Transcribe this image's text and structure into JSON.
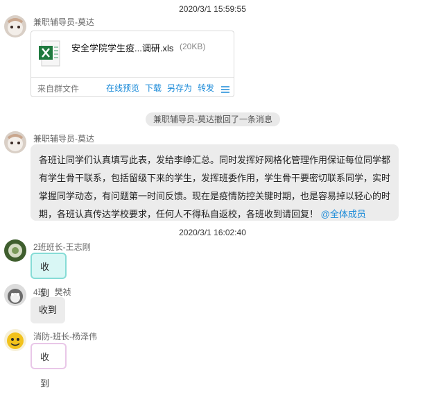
{
  "timestamps": [
    "2020/3/1 15:59:55",
    "2020/3/1 16:02:40"
  ],
  "messages": {
    "m1": {
      "sender": "兼职辅导员-莫达",
      "file": {
        "name": "安全学院学生疫...调研.xls",
        "size": "(20KB)",
        "source": "来自群文件",
        "actions": [
          "在线预览",
          "下载",
          "另存为",
          "转发"
        ]
      }
    },
    "recall_notice": "兼职辅导员-莫达撤回了一条消息",
    "m2": {
      "sender": "兼职辅导员-莫达",
      "text": "各班让同学们认真填写此表，发给李峥汇总。同时发挥好网格化管理作用保证每位同学都有学生骨干联系，包括留级下来的学生，发挥班委作用，学生骨干要密切联系同学，实时掌握同学动态，有问题第一时间反馈。现在是疫情防控关键时期，也是容易掉以轻心的时期，各班认真传达学校要求，任何人不得私自返校，各班收到请回复！",
      "mention": "@全体成员"
    },
    "m3": {
      "sender": "2班班长-王志刚",
      "text": "收到"
    },
    "m4": {
      "sender": "4班　樊祯",
      "text": "收到"
    },
    "m5": {
      "sender": "消防-班长-杨泽伟",
      "text": "收到"
    }
  },
  "colors": {
    "link": "#1a8ad8",
    "excel_green": "#1f7a3f"
  },
  "icons": {
    "file_type": "excel-file-icon",
    "more": "menu-icon"
  }
}
